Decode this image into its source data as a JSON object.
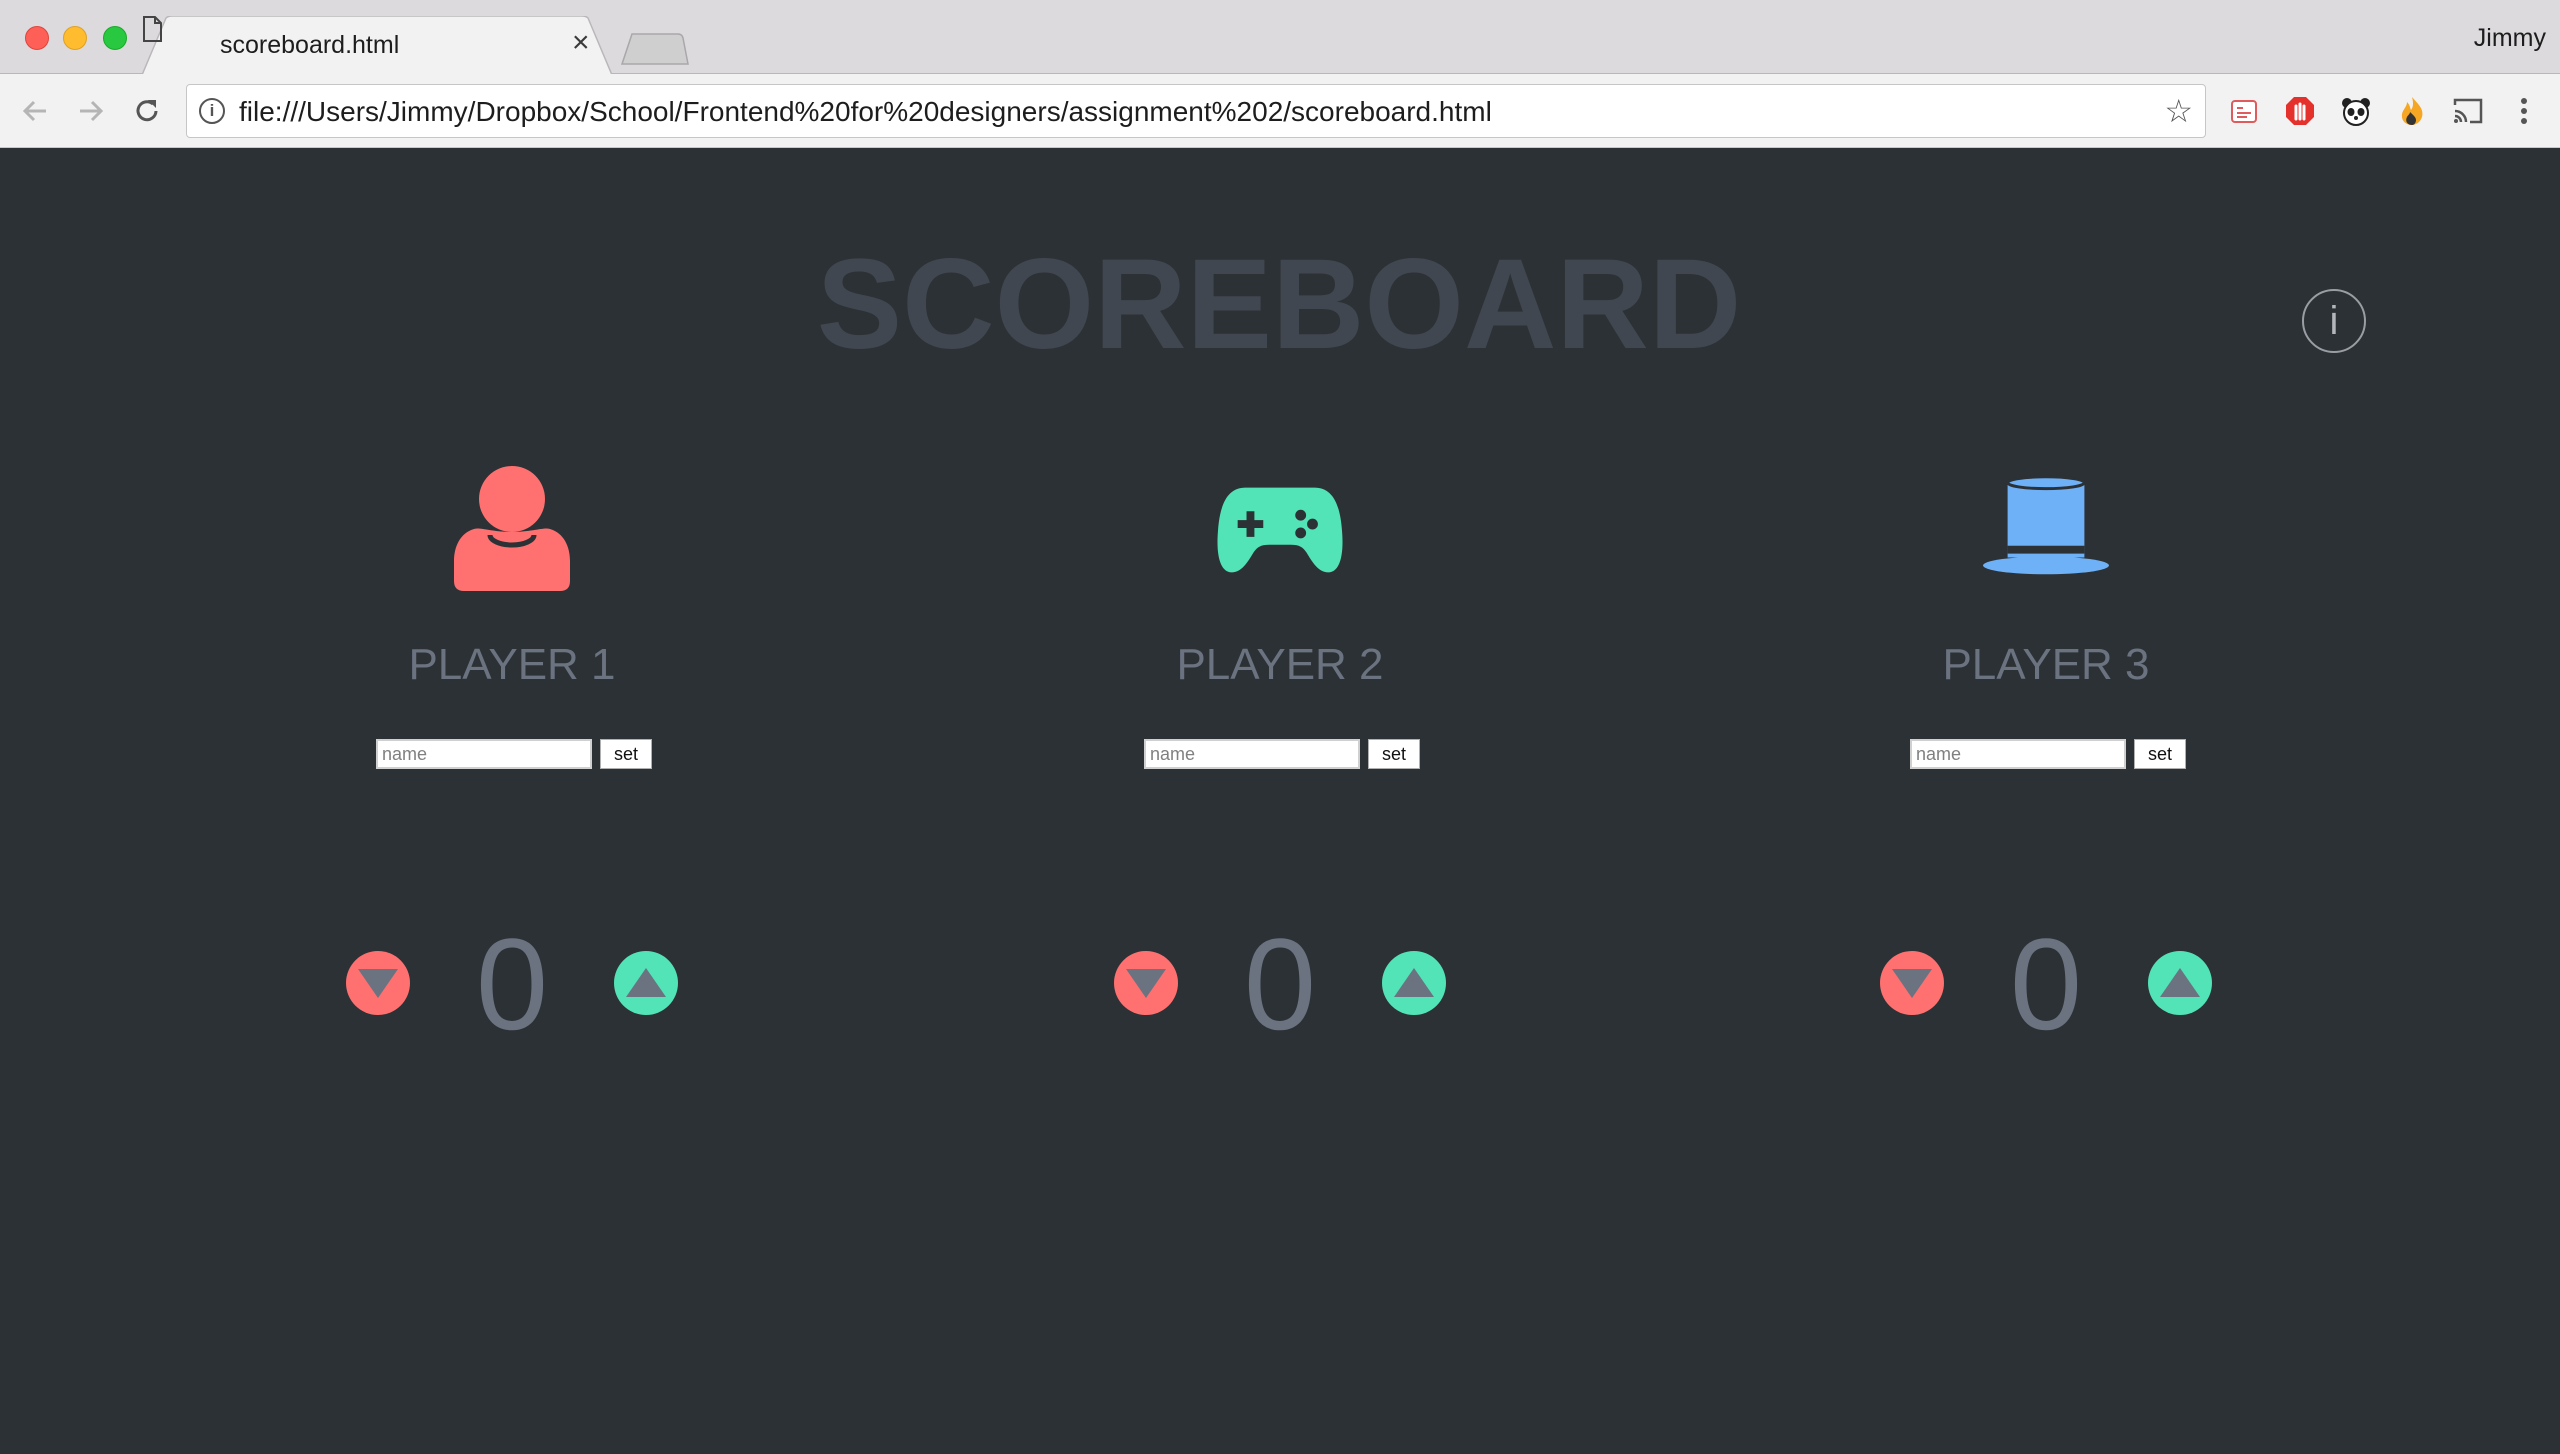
{
  "browser": {
    "tab_title": "scoreboard.html",
    "tab_close_glyph": "×",
    "profile_name": "Jimmy",
    "url": "file:///Users/Jimmy/Dropbox/School/Frontend%20for%20designers/assignment%202/scoreboard.html",
    "star_glyph": "☆",
    "info_glyph": "i",
    "extensions": [
      "lastpass-icon",
      "adblock-icon",
      "panda-icon",
      "flame-icon",
      "cast-icon",
      "menu-icon"
    ]
  },
  "page": {
    "title": "SCOREBOARD",
    "info_glyph": "i"
  },
  "players": [
    {
      "label": "PLAYER 1",
      "icon": "user-icon",
      "color": "#fe7170",
      "name_placeholder": "name",
      "set_label": "set",
      "score": "0"
    },
    {
      "label": "PLAYER 2",
      "icon": "gamepad-icon",
      "color": "#52e3b7",
      "name_placeholder": "name",
      "set_label": "set",
      "score": "0"
    },
    {
      "label": "PLAYER 3",
      "icon": "top-hat-icon",
      "color": "#6fb1f6",
      "name_placeholder": "name",
      "set_label": "set",
      "score": "0"
    }
  ],
  "colors": {
    "background": "#2c3135",
    "title": "#414750",
    "label": "#6b7280",
    "decrement": "#fe7170",
    "increment": "#52e3b7"
  }
}
